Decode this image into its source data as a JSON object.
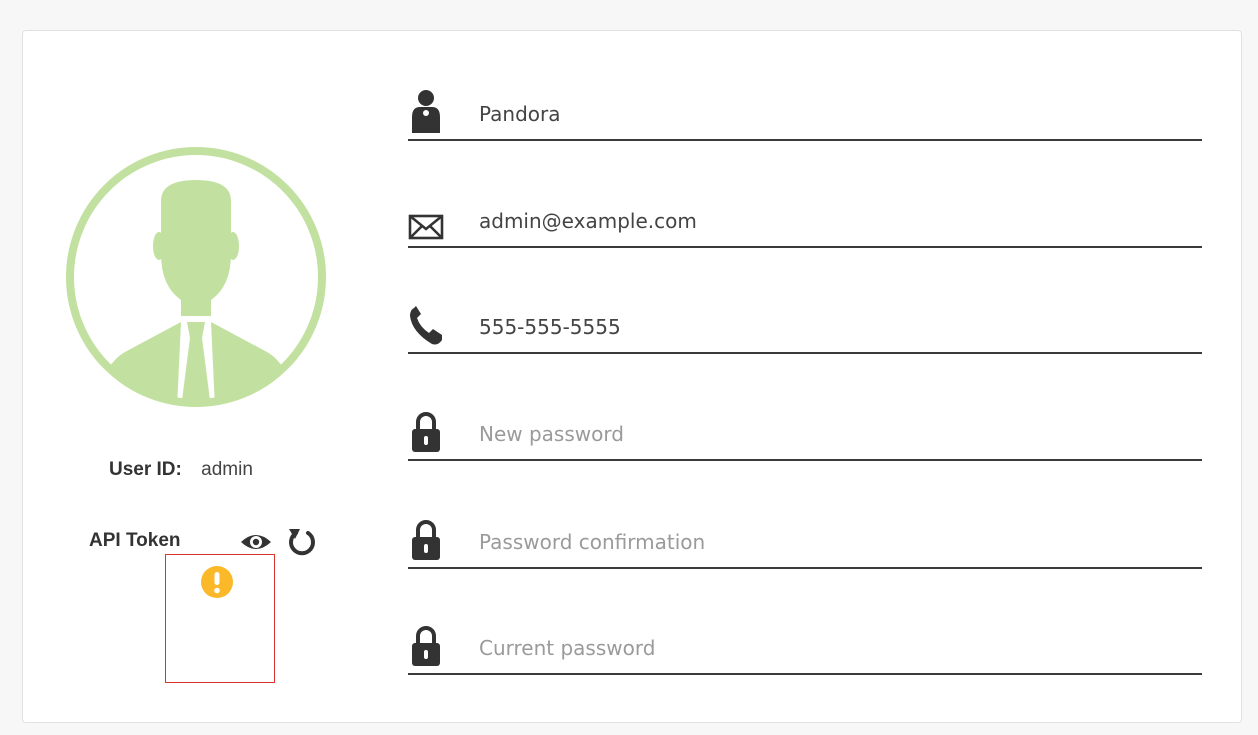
{
  "profile": {
    "user_id_label": "User ID:",
    "user_id_value": "admin",
    "api_token_label": "API Token",
    "avatar_color": "#c2e1a0"
  },
  "form": {
    "fields": [
      {
        "name": "username-field",
        "icon": "user-icon",
        "value": "Pandora",
        "placeholder": "",
        "type": "text"
      },
      {
        "name": "email-field",
        "icon": "envelope-icon",
        "value": "admin@example.com",
        "placeholder": "",
        "type": "text"
      },
      {
        "name": "phone-field",
        "icon": "phone-icon",
        "value": "555-555-5555",
        "placeholder": "",
        "type": "text"
      },
      {
        "name": "new-password-field",
        "icon": "lock-icon",
        "value": "",
        "placeholder": "New password",
        "type": "password"
      },
      {
        "name": "password-confirmation-field",
        "icon": "lock-icon",
        "value": "",
        "placeholder": "Password confirmation",
        "type": "password"
      },
      {
        "name": "current-password-field",
        "icon": "lock-icon",
        "value": "",
        "placeholder": "Current password",
        "type": "password"
      }
    ]
  },
  "colors": {
    "warning": "#fbb829",
    "error_border": "#d9342b",
    "icon": "#333333"
  }
}
